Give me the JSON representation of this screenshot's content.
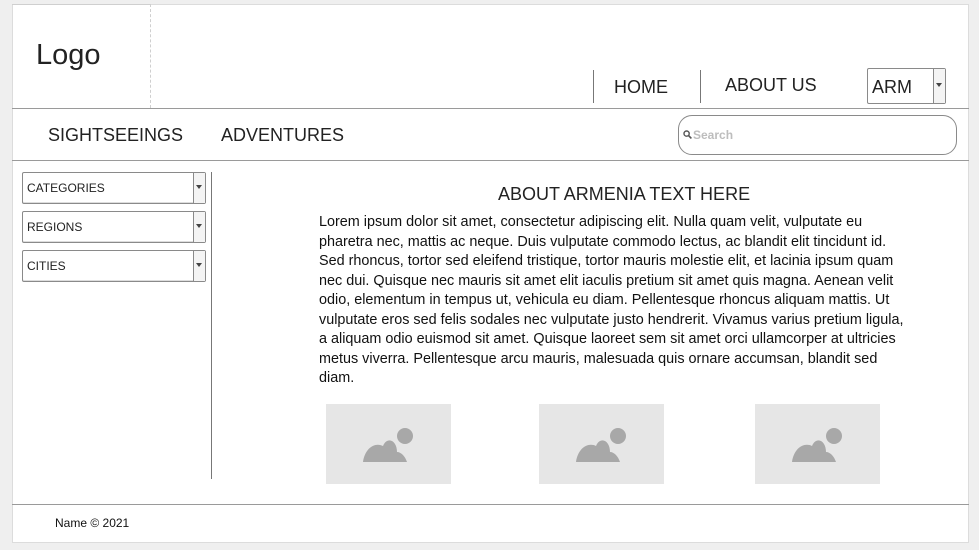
{
  "header": {
    "logo": "Logo",
    "nav": [
      {
        "label": "HOME"
      },
      {
        "label": "ABOUT US"
      }
    ],
    "language": {
      "selected": "ARM"
    }
  },
  "menu": {
    "items": [
      {
        "label": "SIGHTSEEINGS"
      },
      {
        "label": "ADVENTURES"
      }
    ],
    "search": {
      "placeholder": "Search",
      "value": ""
    }
  },
  "sidebar": {
    "filters": [
      {
        "label": "CATEGORIES"
      },
      {
        "label": "REGIONS"
      },
      {
        "label": "CITIES"
      }
    ]
  },
  "main": {
    "title": "ABOUT ARMENIA TEXT HERE",
    "body": "Lorem ipsum dolor sit amet, consectetur adipiscing elit. Nulla quam velit, vulputate eu pharetra nec, mattis ac neque. Duis vulputate commodo lectus, ac blandit elit tincidunt id. Sed rhoncus, tortor sed eleifend tristique, tortor mauris molestie elit, et lacinia ipsum quam nec dui. Quisque nec mauris sit amet elit iaculis pretium sit amet quis magna. Aenean velit odio, elementum in tempus ut, vehicula eu diam. Pellentesque rhoncus aliquam mattis. Ut vulputate eros sed felis sodales nec vulputate justo hendrerit. Vivamus varius pretium ligula, a aliquam odio euismod sit amet. Quisque laoreet sem sit amet orci ullamcorper at ultricies metus viverra. Pellentesque arcu mauris, malesuada quis ornare accumsan, blandit sed diam.",
    "images": [
      {
        "icon": "image-placeholder-icon"
      },
      {
        "icon": "image-placeholder-icon"
      },
      {
        "icon": "image-placeholder-icon"
      }
    ]
  },
  "footer": {
    "text": "Name © 2021"
  },
  "colors": {
    "background": "#efefef",
    "panel": "#ffffff",
    "line": "#9a9a9a",
    "placeholder_fill": "#e6e6e6",
    "placeholder_icon": "#a8a8a8"
  }
}
